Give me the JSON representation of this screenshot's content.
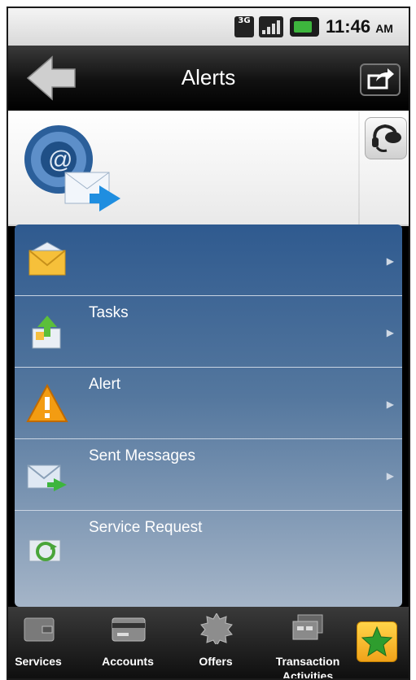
{
  "status_bar": {
    "network": "3G",
    "time": "11:46",
    "ampm": "AM"
  },
  "header": {
    "title": "Alerts"
  },
  "list": {
    "items": [
      {
        "label": "",
        "icon": "envelope-icon"
      },
      {
        "label": "Tasks",
        "icon": "tasks-icon"
      },
      {
        "label": "Alert",
        "icon": "warning-icon"
      },
      {
        "label": "Sent Messages",
        "icon": "sent-mail-icon"
      },
      {
        "label": "Service Request",
        "icon": "service-request-icon"
      }
    ]
  },
  "tabbar": {
    "tabs": [
      {
        "label": "Services",
        "icon": "wallet-icon"
      },
      {
        "label": "Accounts",
        "icon": "card-icon"
      },
      {
        "label": "Offers",
        "icon": "badge-icon"
      },
      {
        "label": "Transaction",
        "label2": "Activities",
        "icon": "receipts-icon"
      }
    ],
    "favorite_icon": "star-icon"
  },
  "colors": {
    "list_top": "#2f5a8f",
    "list_bottom": "#a5b5c8",
    "warning": "#f39c12",
    "accent_green": "#3db53d"
  }
}
